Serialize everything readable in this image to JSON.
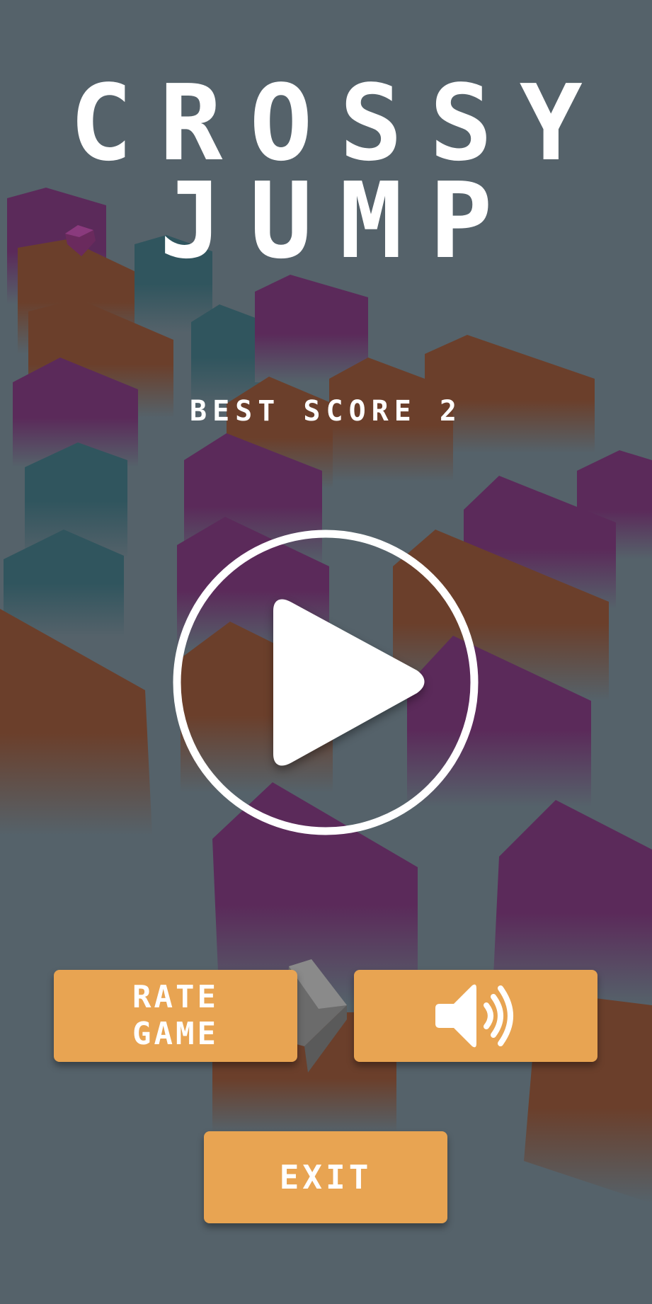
{
  "title": {
    "line1": "CROSSY",
    "line2": "JUMP"
  },
  "best_score": {
    "text": "BEST SCORE 2"
  },
  "buttons": {
    "play_icon": "play-icon",
    "rate_line1": "RATE",
    "rate_line2": "GAME",
    "sound_icon": "speaker-sound-on-icon",
    "exit_label": "EXIT"
  },
  "colors": {
    "background": "#55626a",
    "button": "#e8a452",
    "block_purple": "#5b2a5a",
    "block_orange": "#6b3f2b",
    "block_teal": "#30555e",
    "text": "#ffffff"
  }
}
